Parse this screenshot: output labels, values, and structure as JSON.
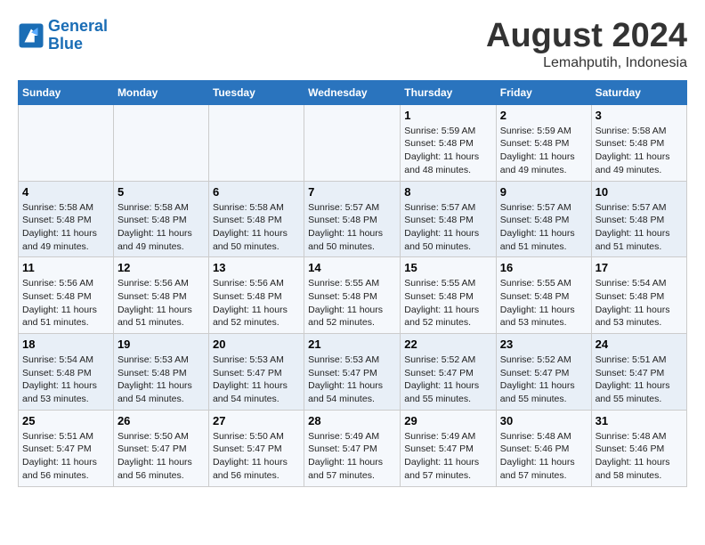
{
  "header": {
    "logo_line1": "General",
    "logo_line2": "Blue",
    "title": "August 2024",
    "subtitle": "Lemahputih, Indonesia"
  },
  "weekdays": [
    "Sunday",
    "Monday",
    "Tuesday",
    "Wednesday",
    "Thursday",
    "Friday",
    "Saturday"
  ],
  "weeks": [
    [
      {
        "day": "",
        "info": ""
      },
      {
        "day": "",
        "info": ""
      },
      {
        "day": "",
        "info": ""
      },
      {
        "day": "",
        "info": ""
      },
      {
        "day": "1",
        "info": "Sunrise: 5:59 AM\nSunset: 5:48 PM\nDaylight: 11 hours\nand 48 minutes."
      },
      {
        "day": "2",
        "info": "Sunrise: 5:59 AM\nSunset: 5:48 PM\nDaylight: 11 hours\nand 49 minutes."
      },
      {
        "day": "3",
        "info": "Sunrise: 5:58 AM\nSunset: 5:48 PM\nDaylight: 11 hours\nand 49 minutes."
      }
    ],
    [
      {
        "day": "4",
        "info": "Sunrise: 5:58 AM\nSunset: 5:48 PM\nDaylight: 11 hours\nand 49 minutes."
      },
      {
        "day": "5",
        "info": "Sunrise: 5:58 AM\nSunset: 5:48 PM\nDaylight: 11 hours\nand 49 minutes."
      },
      {
        "day": "6",
        "info": "Sunrise: 5:58 AM\nSunset: 5:48 PM\nDaylight: 11 hours\nand 50 minutes."
      },
      {
        "day": "7",
        "info": "Sunrise: 5:57 AM\nSunset: 5:48 PM\nDaylight: 11 hours\nand 50 minutes."
      },
      {
        "day": "8",
        "info": "Sunrise: 5:57 AM\nSunset: 5:48 PM\nDaylight: 11 hours\nand 50 minutes."
      },
      {
        "day": "9",
        "info": "Sunrise: 5:57 AM\nSunset: 5:48 PM\nDaylight: 11 hours\nand 51 minutes."
      },
      {
        "day": "10",
        "info": "Sunrise: 5:57 AM\nSunset: 5:48 PM\nDaylight: 11 hours\nand 51 minutes."
      }
    ],
    [
      {
        "day": "11",
        "info": "Sunrise: 5:56 AM\nSunset: 5:48 PM\nDaylight: 11 hours\nand 51 minutes."
      },
      {
        "day": "12",
        "info": "Sunrise: 5:56 AM\nSunset: 5:48 PM\nDaylight: 11 hours\nand 51 minutes."
      },
      {
        "day": "13",
        "info": "Sunrise: 5:56 AM\nSunset: 5:48 PM\nDaylight: 11 hours\nand 52 minutes."
      },
      {
        "day": "14",
        "info": "Sunrise: 5:55 AM\nSunset: 5:48 PM\nDaylight: 11 hours\nand 52 minutes."
      },
      {
        "day": "15",
        "info": "Sunrise: 5:55 AM\nSunset: 5:48 PM\nDaylight: 11 hours\nand 52 minutes."
      },
      {
        "day": "16",
        "info": "Sunrise: 5:55 AM\nSunset: 5:48 PM\nDaylight: 11 hours\nand 53 minutes."
      },
      {
        "day": "17",
        "info": "Sunrise: 5:54 AM\nSunset: 5:48 PM\nDaylight: 11 hours\nand 53 minutes."
      }
    ],
    [
      {
        "day": "18",
        "info": "Sunrise: 5:54 AM\nSunset: 5:48 PM\nDaylight: 11 hours\nand 53 minutes."
      },
      {
        "day": "19",
        "info": "Sunrise: 5:53 AM\nSunset: 5:48 PM\nDaylight: 11 hours\nand 54 minutes."
      },
      {
        "day": "20",
        "info": "Sunrise: 5:53 AM\nSunset: 5:47 PM\nDaylight: 11 hours\nand 54 minutes."
      },
      {
        "day": "21",
        "info": "Sunrise: 5:53 AM\nSunset: 5:47 PM\nDaylight: 11 hours\nand 54 minutes."
      },
      {
        "day": "22",
        "info": "Sunrise: 5:52 AM\nSunset: 5:47 PM\nDaylight: 11 hours\nand 55 minutes."
      },
      {
        "day": "23",
        "info": "Sunrise: 5:52 AM\nSunset: 5:47 PM\nDaylight: 11 hours\nand 55 minutes."
      },
      {
        "day": "24",
        "info": "Sunrise: 5:51 AM\nSunset: 5:47 PM\nDaylight: 11 hours\nand 55 minutes."
      }
    ],
    [
      {
        "day": "25",
        "info": "Sunrise: 5:51 AM\nSunset: 5:47 PM\nDaylight: 11 hours\nand 56 minutes."
      },
      {
        "day": "26",
        "info": "Sunrise: 5:50 AM\nSunset: 5:47 PM\nDaylight: 11 hours\nand 56 minutes."
      },
      {
        "day": "27",
        "info": "Sunrise: 5:50 AM\nSunset: 5:47 PM\nDaylight: 11 hours\nand 56 minutes."
      },
      {
        "day": "28",
        "info": "Sunrise: 5:49 AM\nSunset: 5:47 PM\nDaylight: 11 hours\nand 57 minutes."
      },
      {
        "day": "29",
        "info": "Sunrise: 5:49 AM\nSunset: 5:47 PM\nDaylight: 11 hours\nand 57 minutes."
      },
      {
        "day": "30",
        "info": "Sunrise: 5:48 AM\nSunset: 5:46 PM\nDaylight: 11 hours\nand 57 minutes."
      },
      {
        "day": "31",
        "info": "Sunrise: 5:48 AM\nSunset: 5:46 PM\nDaylight: 11 hours\nand 58 minutes."
      }
    ]
  ]
}
